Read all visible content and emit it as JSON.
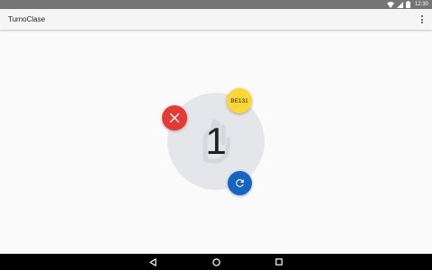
{
  "status_bar": {
    "time": "12:30",
    "icons": [
      "wifi-icon",
      "signal-icon",
      "battery-icon"
    ],
    "background": "#757575"
  },
  "app_bar": {
    "title": "TurnoClase",
    "menu_icon": "more-vert-icon"
  },
  "main": {
    "turn_number": "1",
    "code_badge": "BE131",
    "cancel_icon": "close-icon",
    "refresh_icon": "refresh-icon",
    "colors": {
      "circle": "#e4e6e9",
      "cancel": "#e53935",
      "badge": "#fdd835",
      "refresh": "#1565c0"
    }
  },
  "nav_bar": {
    "icons": [
      "back-icon",
      "home-icon",
      "recents-icon"
    ]
  }
}
